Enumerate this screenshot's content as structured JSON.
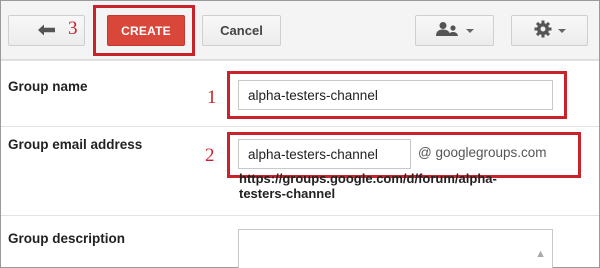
{
  "toolbar": {
    "create_label": "CREATE",
    "cancel_label": "Cancel"
  },
  "annotations": {
    "one": "1",
    "two": "2",
    "three": "3"
  },
  "form": {
    "group_name_label": "Group name",
    "group_name_value": "alpha-testers-channel",
    "group_email_label": "Group email address",
    "group_email_value": "alpha-testers-channel",
    "group_email_suffix": "@ googlegroups.com",
    "group_url": "https://groups.google.com/d/forum/alpha-testers-channel",
    "group_description_label": "Group description"
  },
  "icons": {
    "back": "back-arrow-icon",
    "members": "add-members-icon",
    "settings": "gear-icon"
  },
  "colors": {
    "create_button": "#d9463a",
    "annotation": "#c8222b"
  }
}
